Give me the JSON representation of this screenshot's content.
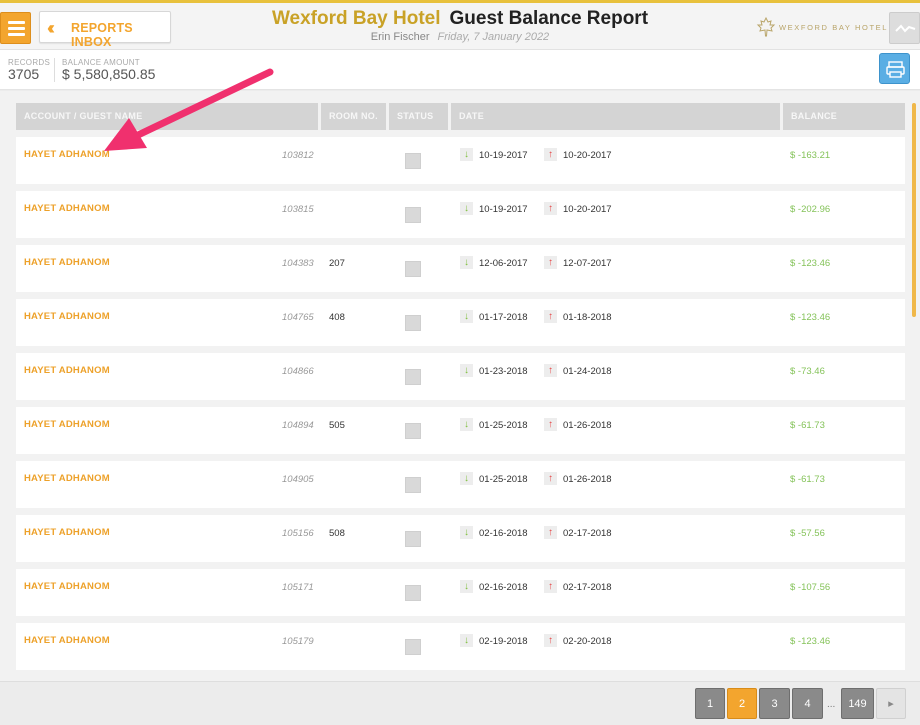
{
  "header": {
    "inbox_label": "REPORTS INBOX",
    "hotel_name": "Wexford Bay Hotel",
    "report_title": "Guest Balance Report",
    "user": "Erin Fischer",
    "date": "Friday, 7 January 2022",
    "logo_text": "WEXFORD BAY HOTEL"
  },
  "summary": {
    "records_label": "RECORDS",
    "records_value": "3705",
    "balance_label": "BALANCE AMOUNT",
    "balance_value": "$ 5,580,850.85"
  },
  "table": {
    "columns": [
      "ACCOUNT / GUEST NAME",
      "ROOM NO.",
      "STATUS",
      "DATE",
      "BALANCE"
    ],
    "rows": [
      {
        "guest": "HAYET ADHANOM",
        "account": "103812",
        "room": "",
        "arrival": "10-19-2017",
        "departure": "10-20-2017",
        "balance": "$ -163.21"
      },
      {
        "guest": "HAYET ADHANOM",
        "account": "103815",
        "room": "",
        "arrival": "10-19-2017",
        "departure": "10-20-2017",
        "balance": "$ -202.96"
      },
      {
        "guest": "HAYET ADHANOM",
        "account": "104383",
        "room": "207",
        "arrival": "12-06-2017",
        "departure": "12-07-2017",
        "balance": "$ -123.46"
      },
      {
        "guest": "HAYET ADHANOM",
        "account": "104765",
        "room": "408",
        "arrival": "01-17-2018",
        "departure": "01-18-2018",
        "balance": "$ -123.46"
      },
      {
        "guest": "HAYET ADHANOM",
        "account": "104866",
        "room": "",
        "arrival": "01-23-2018",
        "departure": "01-24-2018",
        "balance": "$ -73.46"
      },
      {
        "guest": "HAYET ADHANOM",
        "account": "104894",
        "room": "505",
        "arrival": "01-25-2018",
        "departure": "01-26-2018",
        "balance": "$ -61.73"
      },
      {
        "guest": "HAYET ADHANOM",
        "account": "104905",
        "room": "",
        "arrival": "01-25-2018",
        "departure": "01-26-2018",
        "balance": "$ -61.73"
      },
      {
        "guest": "HAYET ADHANOM",
        "account": "105156",
        "room": "508",
        "arrival": "02-16-2018",
        "departure": "02-17-2018",
        "balance": "$ -57.56"
      },
      {
        "guest": "HAYET ADHANOM",
        "account": "105171",
        "room": "",
        "arrival": "02-16-2018",
        "departure": "02-17-2018",
        "balance": "$ -107.56"
      },
      {
        "guest": "HAYET ADHANOM",
        "account": "105179",
        "room": "",
        "arrival": "02-19-2018",
        "departure": "02-20-2018",
        "balance": "$ -123.46"
      }
    ]
  },
  "pagination": {
    "pages": [
      "1",
      "2",
      "3",
      "4"
    ],
    "ellipsis": "...",
    "last": "149",
    "current": "2"
  },
  "icons": {
    "menu": "hamburger-icon",
    "back": "double-chevron-left-icon",
    "logo": "maple-leaf-icon",
    "activity": "activity-icon",
    "print": "printer-icon",
    "arrival": "arrow-down-icon",
    "departure": "arrow-up-icon",
    "next": "triangle-right-icon"
  },
  "colors": {
    "accent": "#f3a52e",
    "hotel_gold": "#c9a227",
    "balance_green": "#85c35a",
    "annotation": "#f0306e"
  }
}
